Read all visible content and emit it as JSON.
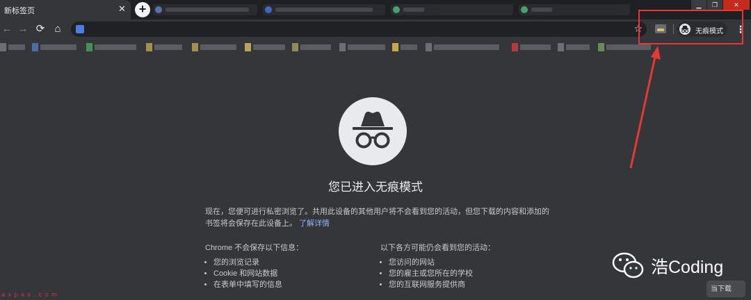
{
  "window": {
    "active_tab_title": "新标签页",
    "tab_close_glyph": "✕",
    "new_tab_glyph": "+",
    "controls": {
      "minimize": "▁",
      "maximize": "❐",
      "close": "✕"
    }
  },
  "toolbar": {
    "back_icon": "←",
    "forward_icon": "→",
    "reload_icon": "⟳",
    "home_icon": "⌂",
    "star_icon": "☆",
    "omnibox_value": "",
    "incognito_label": "无痕模式",
    "menu_icon": "⋮"
  },
  "content": {
    "heading": "您已进入无痕模式",
    "intro_text": "现在，您便可进行私密浏览了。共用此设备的其他用户将不会看到您的活动，但您下载的内容和添加的书签将会保存在此设备上。",
    "learn_more": "了解详情",
    "left_column": {
      "title": "Chrome 不会保存以下信息：",
      "items": [
        "您的浏览记录",
        "Cookie 和网站数据",
        "在表单中填写的信息"
      ]
    },
    "right_column": {
      "title": "以下各方可能仍会看到您的活动：",
      "items": [
        "您访问的网站",
        "您的雇主或您所在的学校",
        "您的互联网服务提供商"
      ]
    }
  },
  "watermark": {
    "text": "浩Coding",
    "corner_text": "a x p a s . c o m",
    "corner_logo": "当下载"
  },
  "colors": {
    "background": "#35363a",
    "accent_link": "#8ab4f8",
    "highlight": "#e53935"
  }
}
